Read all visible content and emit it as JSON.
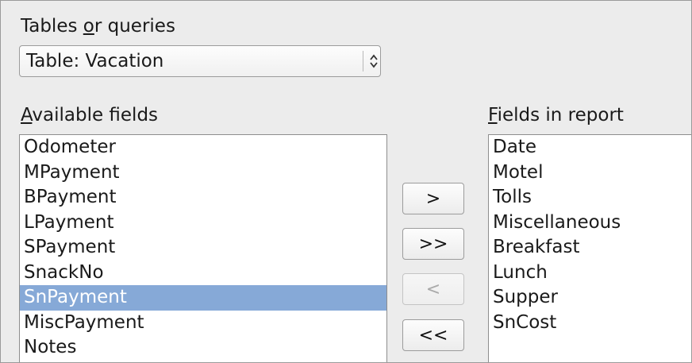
{
  "tables_or_queries": {
    "label_pre": "Tables ",
    "label_access": "o",
    "label_post": "r queries",
    "selected": "Table: Vacation"
  },
  "available_fields": {
    "label_access": "A",
    "label_rest": "vailable fields",
    "items": [
      "Odometer",
      "MPayment",
      "BPayment",
      "LPayment",
      "SPayment",
      "SnackNo",
      "SnPayment",
      "MiscPayment",
      "Notes"
    ],
    "selected": "SnPayment"
  },
  "fields_in_report": {
    "label_access": "F",
    "label_rest": "ields in report",
    "items": [
      "Date",
      "Motel",
      "Tolls",
      "Miscellaneous",
      "Breakfast",
      "Lunch",
      "Supper",
      "SnCost"
    ]
  },
  "buttons": {
    "add": ">",
    "add_all": ">>",
    "remove": "<",
    "remove_all": "<<"
  }
}
